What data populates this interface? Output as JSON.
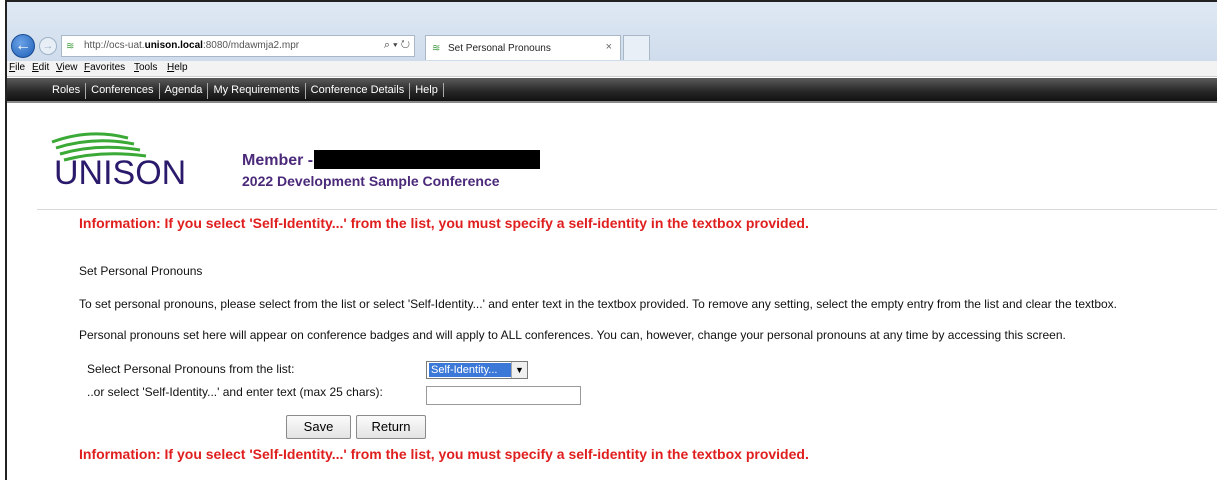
{
  "browser": {
    "url_prefix": "http://ocs-uat.",
    "url_host": "unison.local",
    "url_suffix": ":8080/mdawmja2.mpr",
    "address_tools": "⌕ ▾ ↻",
    "tab_title": "Set Personal Pronouns",
    "menu": [
      "File",
      "Edit",
      "View",
      "Favorites",
      "Tools",
      "Help"
    ]
  },
  "app_nav": {
    "items": [
      "Roles",
      "Conferences",
      "Agenda",
      "My Requirements",
      "Conference Details",
      "Help"
    ]
  },
  "header": {
    "logo_text": "UNISON",
    "member_label": "Member -",
    "conference_name": "2022 Development Sample Conference"
  },
  "info_message": "Information: If you select 'Self-Identity...' from the list, you must specify a self-identity in the textbox provided.",
  "page": {
    "section_title": "Set Personal Pronouns",
    "paragraph_1": "To set personal pronouns, please select from the list or select 'Self-Identity...' and enter text in the textbox provided. To remove any setting, select the empty entry from the list and clear the textbox.",
    "paragraph_2": "Personal pronouns set here will appear on conference badges and will apply to ALL conferences. You can, however, change your personal pronouns at any time by accessing this screen."
  },
  "form": {
    "select_label": "Select Personal Pronouns from the list:",
    "select_value": "Self-Identity...",
    "text_label": "..or select 'Self-Identity...' and enter text (max 25 chars):",
    "text_value": "",
    "save_label": "Save",
    "return_label": "Return"
  },
  "colors": {
    "info_red": "#e01e1e",
    "member_purple": "#4b2a7a",
    "logo_green": "#3aa935",
    "logo_navy": "#2b1a6b"
  }
}
